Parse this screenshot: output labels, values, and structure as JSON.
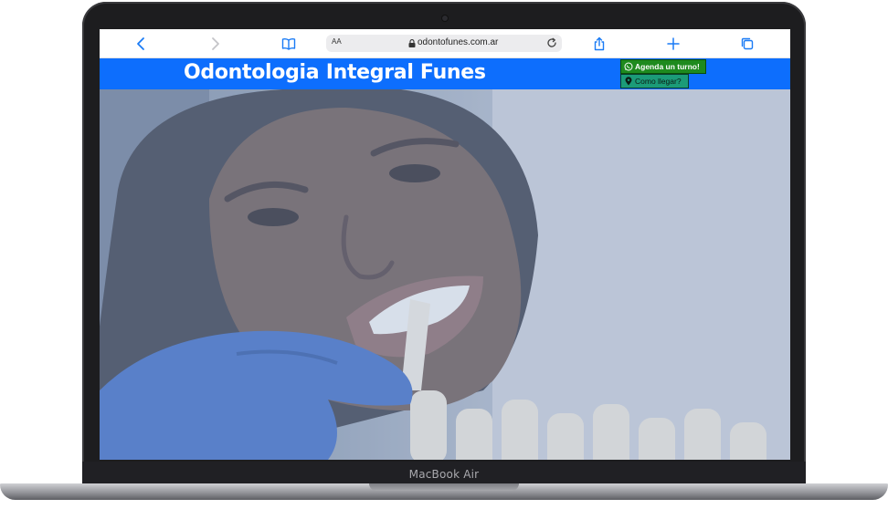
{
  "device": {
    "model_label": "MacBook Air"
  },
  "browser": {
    "address": {
      "aa_label": "AA",
      "url": "odontofunes.com.ar"
    }
  },
  "site": {
    "title": "Odontologia Integral Funes",
    "buttons": {
      "turno": "Agenda un turno!",
      "llegar": "Como llegar?"
    }
  },
  "colors": {
    "header_blue": "#0d6efd",
    "turno_green": "#1e8a1e",
    "llegar_teal": "#1b9b78",
    "safari_accent": "#1a7bf5"
  },
  "icons": {
    "back": "chevron-left-icon",
    "forward": "chevron-right-icon",
    "bookmarks": "book-icon",
    "lock": "lock-icon",
    "reload": "reload-icon",
    "share": "share-icon",
    "new_tab": "plus-icon",
    "tabs": "tabs-icon",
    "whatsapp": "whatsapp-icon",
    "location": "map-pin-icon"
  }
}
